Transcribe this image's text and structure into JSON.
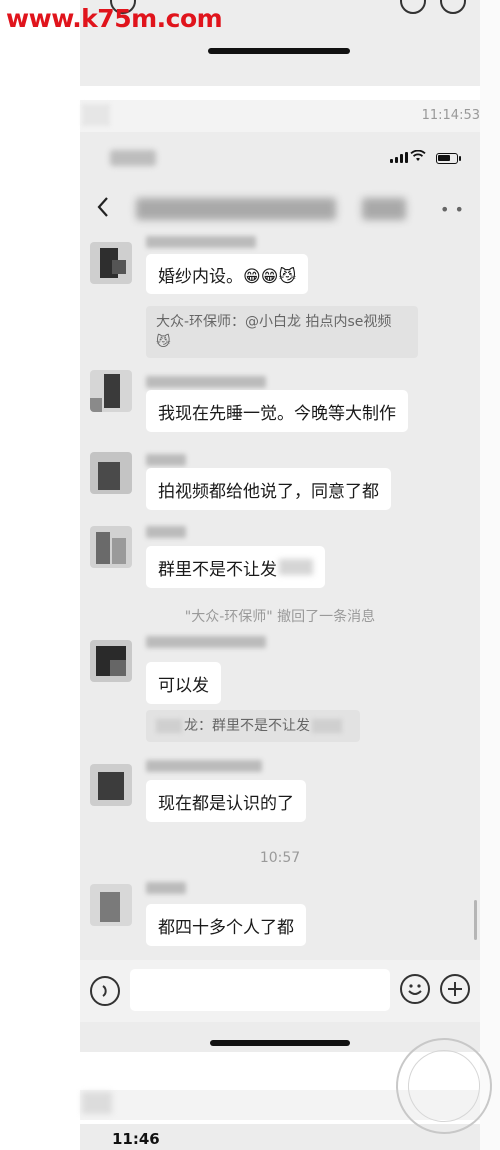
{
  "watermark_site": "www.k75m.com",
  "top_timestamp": "11:14:53",
  "bottom_status_time": "11:46",
  "messages": [
    {
      "text": "婚纱内设。😁😁😼"
    },
    {
      "text": "我现在先睡一觉。今晚等大制作"
    },
    {
      "text": "拍视频都给他说了，同意了都"
    },
    {
      "text": "群里不是不让发"
    },
    {
      "text": "可以发"
    },
    {
      "text": "现在都是认识的了"
    },
    {
      "text": "都四十多个人了都"
    }
  ],
  "quote_1": {
    "text": "大众-环保师：@小白龙 拍点内se视频",
    "emoji": "😼"
  },
  "quote_2": {
    "text": "龙：群里不是不让发"
  },
  "system_notice": "\"大众-环保师\" 撤回了一条消息",
  "chat_timestamp": "10:57",
  "colors": {
    "watermark": "#e0141c",
    "screen_bg": "#ececec",
    "bubble": "#ffffff"
  }
}
